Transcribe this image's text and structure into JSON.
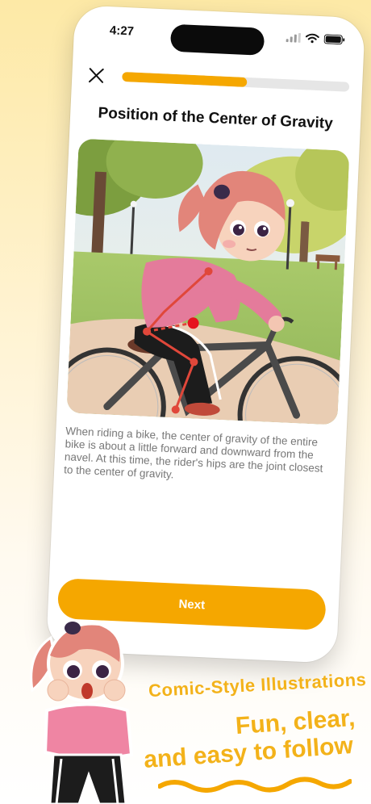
{
  "status_bar": {
    "time": "4:27"
  },
  "header": {
    "progress_fraction": 0.55
  },
  "lesson": {
    "title": "Position of the Center of Gravity",
    "description": "When riding a bike, the center of gravity of the entire bike is about a little forward and downward from the navel. At this time, the rider's hips are the joint closest to the center of gravity."
  },
  "actions": {
    "next_label": "Next"
  },
  "promo": {
    "line1": "Comic-Style Illustrations",
    "line2": "Fun, clear,",
    "line3": "and easy to follow"
  },
  "colors": {
    "accent": "#f5a700",
    "promo_text": "#f3b21a"
  }
}
